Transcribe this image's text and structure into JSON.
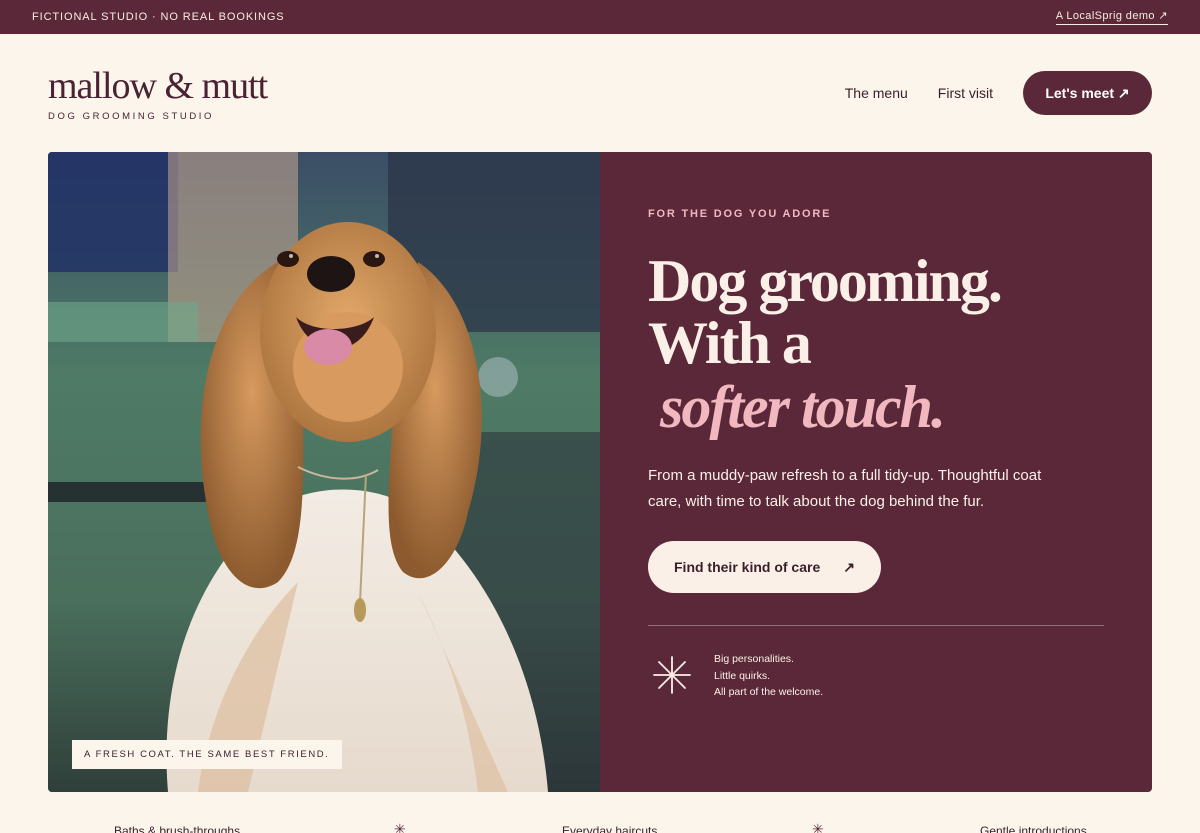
{
  "topbar": {
    "left_text": "FICTIONAL STUDIO · NO REAL BOOKINGS",
    "right_link": "A LocalSprig demo ↗"
  },
  "brand": {
    "name": "mallow & mutt",
    "tagline": "DOG GROOMING STUDIO"
  },
  "nav": {
    "links": [
      "The menu",
      "First visit"
    ],
    "cta": "Let's meet ↗"
  },
  "hero": {
    "photo_caption": "A FRESH COAT. THE SAME BEST FRIEND.",
    "eyebrow": "FOR THE DOG YOU ADORE",
    "headline_line1": "Dog grooming.",
    "headline_line2": "With a",
    "headline_accent": "softer touch.",
    "lede": "From a muddy-paw refresh to a full tidy-up. Thoughtful coat care, with time to talk about the dog behind the fur.",
    "cta_label": "Find their kind of care",
    "cta_icon": "↗",
    "quirks": [
      "Big personalities.",
      "Little quirks.",
      "All part of the welcome."
    ]
  },
  "strip": {
    "items": [
      "Baths & brush-throughs",
      "Everyday haircuts",
      "Gentle introductions"
    ],
    "separator": "✳"
  },
  "colors": {
    "plum": "#5a2839",
    "cream": "#fbf5ec",
    "pink_accent": "#f2b8c0"
  },
  "icons": {
    "photo_subject": "cocker-spaniel-photo",
    "sparkle": "sparkle-icon"
  }
}
